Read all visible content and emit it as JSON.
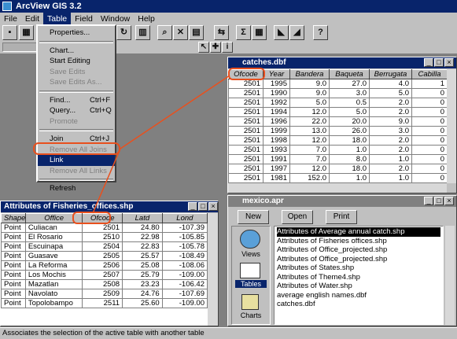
{
  "app": {
    "title": "ArcView GIS 3.2"
  },
  "menubar": [
    "File",
    "Edit",
    "Table",
    "Field",
    "Window",
    "Help"
  ],
  "table_menu": {
    "items": [
      {
        "label": "Properties...",
        "shortcut": "",
        "disabled": false,
        "sep_after": true
      },
      {
        "label": "Chart...",
        "shortcut": "",
        "disabled": false,
        "sep_after": false
      },
      {
        "label": "Start Editing",
        "shortcut": "",
        "disabled": false,
        "sep_after": false
      },
      {
        "label": "Save Edits",
        "shortcut": "",
        "disabled": true,
        "sep_after": false
      },
      {
        "label": "Save Edits As...",
        "shortcut": "",
        "disabled": true,
        "sep_after": true
      },
      {
        "label": "Find...",
        "shortcut": "Ctrl+F",
        "disabled": false,
        "sep_after": false
      },
      {
        "label": "Query...",
        "shortcut": "Ctrl+Q",
        "disabled": false,
        "sep_after": false
      },
      {
        "label": "Promote",
        "shortcut": "",
        "disabled": true,
        "sep_after": true
      },
      {
        "label": "Join",
        "shortcut": "Ctrl+J",
        "disabled": false,
        "sep_after": false
      },
      {
        "label": "Remove All Joins",
        "shortcut": "",
        "disabled": true,
        "sep_after": false
      },
      {
        "label": "Link",
        "shortcut": "",
        "disabled": false,
        "sep_after": false,
        "highlight": true
      },
      {
        "label": "Remove All Links",
        "shortcut": "",
        "disabled": true,
        "sep_after": true
      },
      {
        "label": "Refresh",
        "shortcut": "",
        "disabled": false,
        "sep_after": false
      }
    ]
  },
  "catches_window": {
    "title": "catches.dbf",
    "columns": [
      "Ofcode",
      "Year",
      "Bandera",
      "Baqueta",
      "Berrugata",
      "Cabilla"
    ],
    "rows": [
      [
        "2501",
        "1995",
        "9.0",
        "27.0",
        "4.0",
        "1"
      ],
      [
        "2501",
        "1990",
        "9.0",
        "3.0",
        "5.0",
        "0"
      ],
      [
        "2501",
        "1992",
        "5.0",
        "0.5",
        "2.0",
        "0"
      ],
      [
        "2501",
        "1994",
        "12.0",
        "5.0",
        "2.0",
        "0"
      ],
      [
        "2501",
        "1996",
        "22.0",
        "20.0",
        "9.0",
        "0"
      ],
      [
        "2501",
        "1999",
        "13.0",
        "26.0",
        "3.0",
        "0"
      ],
      [
        "2501",
        "1998",
        "12.0",
        "18.0",
        "2.0",
        "0"
      ],
      [
        "2501",
        "1993",
        "7.0",
        "1.0",
        "2.0",
        "0"
      ],
      [
        "2501",
        "1991",
        "7.0",
        "8.0",
        "1.0",
        "0"
      ],
      [
        "2501",
        "1997",
        "12.0",
        "18.0",
        "2.0",
        "0"
      ],
      [
        "2501",
        "1981",
        "152.0",
        "1.0",
        "1.0",
        "0"
      ]
    ]
  },
  "offices_window": {
    "title": "Attributes of Fisheries_offices.shp",
    "columns": [
      "Shape",
      "Office",
      "Ofcode",
      "Latd",
      "Lond"
    ],
    "rows": [
      [
        "Point",
        "Culiacan",
        "2501",
        "24.80",
        "-107.39"
      ],
      [
        "Point",
        "El Rosario",
        "2510",
        "22.98",
        "-105.85"
      ],
      [
        "Point",
        "Escuinapa",
        "2504",
        "22.83",
        "-105.78"
      ],
      [
        "Point",
        "Guasave",
        "2505",
        "25.57",
        "-108.49"
      ],
      [
        "Point",
        "La Reforma",
        "2506",
        "25.08",
        "-108.06"
      ],
      [
        "Point",
        "Los Mochis",
        "2507",
        "25.79",
        "-109.00"
      ],
      [
        "Point",
        "Mazatlan",
        "2508",
        "23.23",
        "-106.42"
      ],
      [
        "Point",
        "Navolato",
        "2509",
        "24.76",
        "-107.69"
      ],
      [
        "Point",
        "Topolobampo",
        "2511",
        "25.60",
        "-109.00"
      ]
    ]
  },
  "project_window": {
    "title": "mexico.apr",
    "buttons": [
      "New",
      "Open",
      "Print"
    ],
    "icons": [
      "Views",
      "Tables",
      "Charts"
    ],
    "items": [
      "Attributes of Average annual catch.shp",
      "Attributes of Fisheries offices.shp",
      "Attributes of Office_projected.shp",
      "Attributes of Office_projected.shp",
      "Attributes of States.shp",
      "Attributes of Theme4.shp",
      "Attributes of Water.shp",
      "average english names.dbf",
      "catches.dbf"
    ]
  },
  "statusbar": {
    "text": "Associates the selection of the active table with another table"
  },
  "colors": {
    "titlebar": "#08246b",
    "highlight": "#e8501e",
    "face": "#c0c0c0"
  }
}
